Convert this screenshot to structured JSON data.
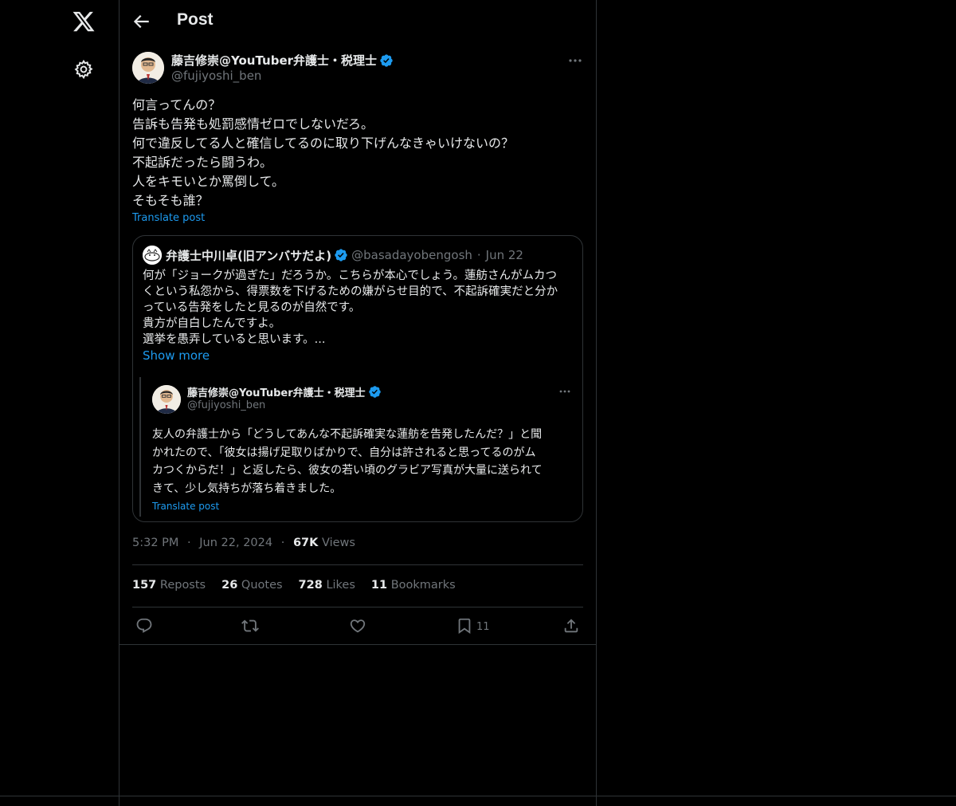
{
  "nav": {
    "logo_icon": "x-logo-icon",
    "settings_icon": "gear-icon"
  },
  "header": {
    "title": "Post",
    "back_icon": "arrow-left-icon"
  },
  "post": {
    "author_name": "藤吉修崇@YouTuber弁護士・税理士",
    "author_handle": "@fujiyoshi_ben",
    "verified": true,
    "lines": [
      "何言ってんの？",
      "告訴も告発も処罰感情ゼロでしないだろ。",
      "何で違反してる人と確信してるのに取り下げんなきゃいけないの？",
      "不起訴だったら闘うわ。",
      "人をキモいとか罵倒して。",
      "そもそも誰？"
    ],
    "translate_label": "Translate post",
    "time": "5:32 PM",
    "date": "Jun 22, 2024",
    "views_count": "67K",
    "views_label": "Views",
    "sep": "·"
  },
  "quote": {
    "author_name": "弁護士中川卓(旧アンバサだよ)",
    "author_handle": "@basadayobengosh",
    "date": "Jun 22",
    "sep": "·",
    "lines": [
      "何が「ジョークが過ぎた」だろうか。こちらが本心でしょう。蓮舫さんがムカつ",
      "くという私怨から、得票数を下げるための嫌がらせ目的で、不起訴確実だと分か",
      "っている告発をしたと見るのが自然です。",
      "貴方が自白したんですよ。",
      "選挙を愚弄していると思います。..."
    ],
    "show_more": "Show more"
  },
  "embedded": {
    "author_name": "藤吉修崇@YouTuber弁護士・税理士",
    "author_handle": "@fujiyoshi_ben",
    "lines": [
      "友人の弁護士から「どうしてあんな不起訴確実な蓮舫を告発したんだ？」と聞",
      "かれたので、「彼女は揚げ足取りばかりで、自分は許されると思ってるのがム",
      "カつくからだ！」と返したら、彼女の若い頃のグラビア写真が大量に送られて",
      "きて、少し気持ちが落ち着きました。"
    ],
    "translate_label": "Translate post"
  },
  "stats": [
    {
      "num": "157",
      "label": "Reposts"
    },
    {
      "num": "26",
      "label": "Quotes"
    },
    {
      "num": "728",
      "label": "Likes"
    },
    {
      "num": "11",
      "label": "Bookmarks"
    }
  ],
  "actions": {
    "reply_icon": "reply-icon",
    "repost_icon": "repost-icon",
    "like_icon": "heart-icon",
    "bookmark_icon": "bookmark-icon",
    "bookmark_count": "11",
    "share_icon": "share-icon"
  },
  "colors": {
    "accent": "#1d9bf0",
    "border": "#2f3336",
    "muted": "#71767b",
    "text": "#e7e9ea",
    "background": "#000000"
  }
}
